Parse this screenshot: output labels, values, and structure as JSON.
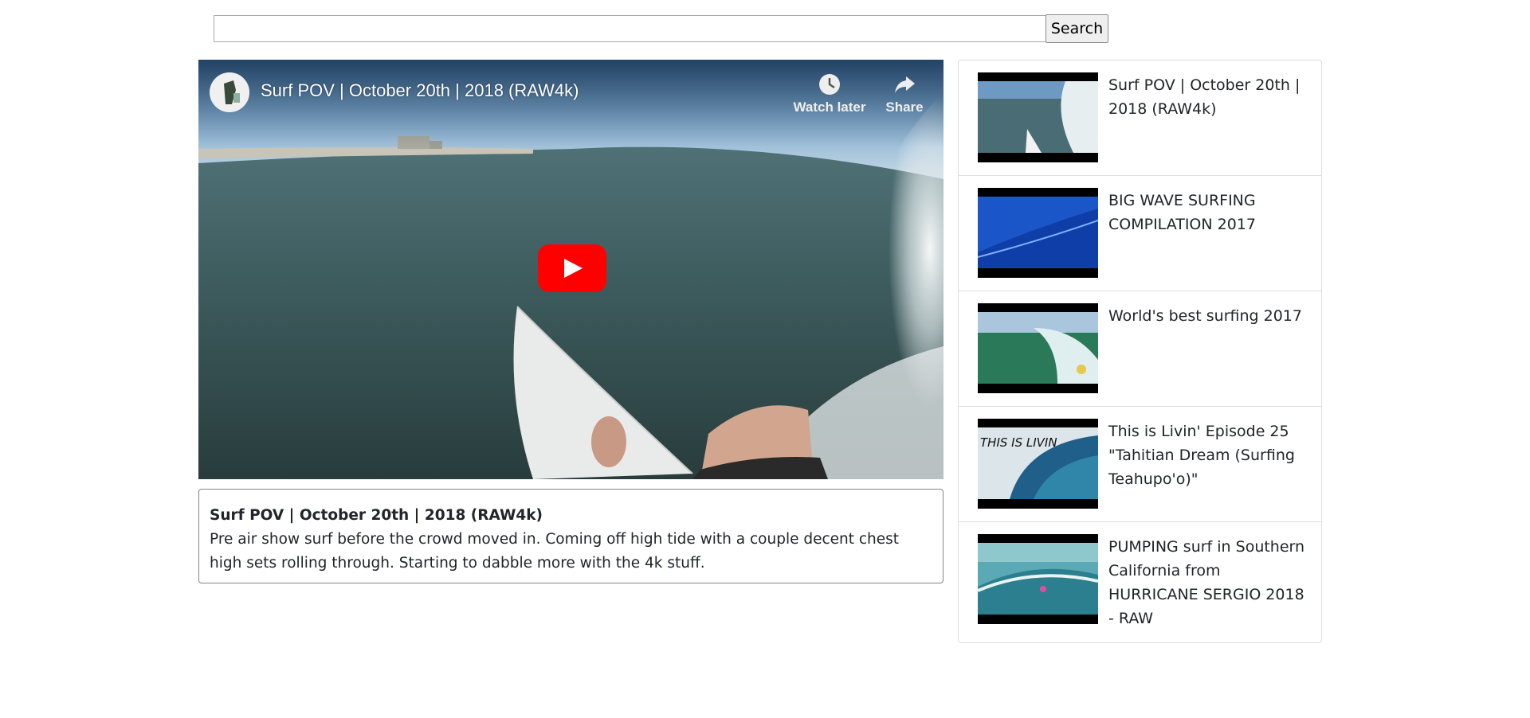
{
  "search": {
    "value": "",
    "button_label": "Search"
  },
  "player": {
    "title": "Surf POV | October 20th | 2018 (RAW4k)",
    "watch_later_label": "Watch later",
    "share_label": "Share"
  },
  "description": {
    "title": "Surf POV | October 20th | 2018 (RAW4k)",
    "text": "Pre air show surf before the crowd moved in. Coming off high tide with a couple decent chest high sets rolling through. Starting to dabble more with the 4k stuff."
  },
  "videos": [
    {
      "title": "Surf POV | October 20th | 2018 (RAW4k)"
    },
    {
      "title": "BIG WAVE SURFING COMPILATION 2017"
    },
    {
      "title": "World's best surfing 2017"
    },
    {
      "title": "This is Livin' Episode 25 \"Tahitian Dream (Surfing Teahupo'o)\"",
      "thumb_text": "THIS IS LIVIN"
    },
    {
      "title": "PUMPING surf in Southern California from HURRICANE SERGIO 2018 - RAW"
    }
  ],
  "colors": {
    "play_button": "#ff0000",
    "card_border": "#858585",
    "list_border": "#dfdfdf"
  },
  "icons": {
    "watch_later": "clock-icon",
    "share": "share-arrow-icon",
    "play": "play-icon"
  }
}
